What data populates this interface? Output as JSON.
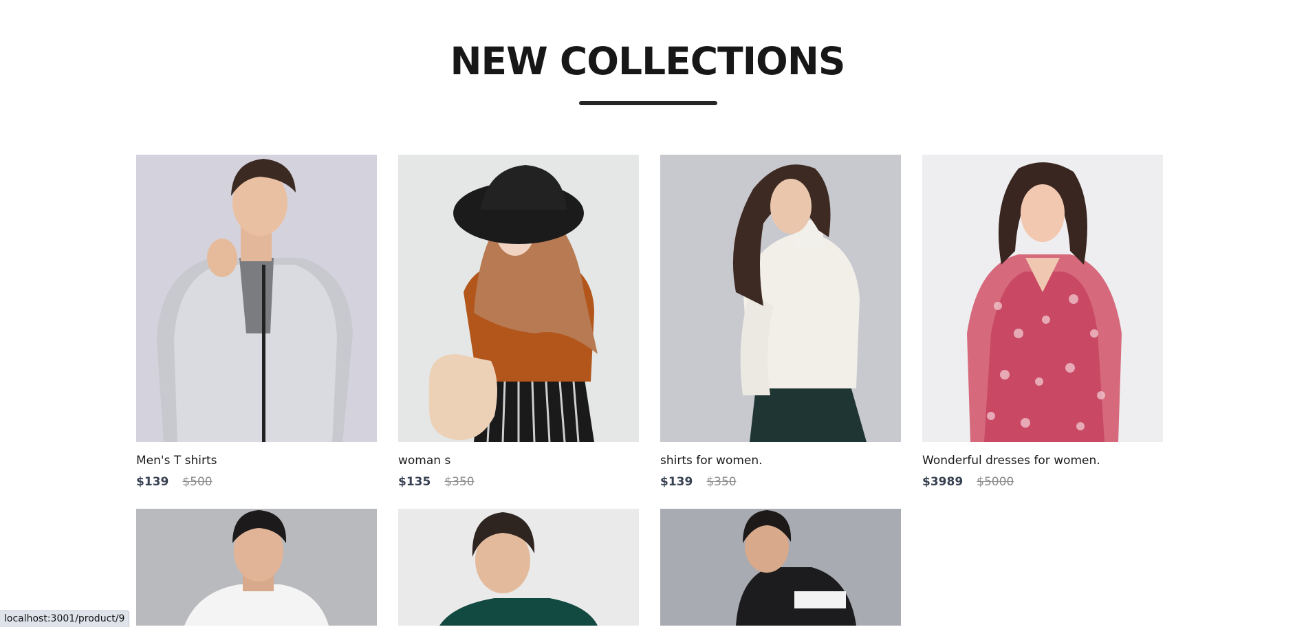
{
  "section": {
    "title": "NEW COLLECTIONS"
  },
  "products": [
    {
      "name": "Men's T shirts",
      "price_new": "$139",
      "price_old": "$500",
      "image": "man-grey-jacket-photo"
    },
    {
      "name": "woman s",
      "price_new": "$135",
      "price_old": "$350",
      "image": "woman-hijab-hat-photo"
    },
    {
      "name": "shirts for women.",
      "price_new": "$139",
      "price_old": "$350",
      "image": "woman-white-turtleneck-photo"
    },
    {
      "name": "Wonderful dresses for women.",
      "price_new": "$3989",
      "price_old": "$5000",
      "image": "woman-floral-dress-photo"
    },
    {
      "image": "man-white-hoodie-photo"
    },
    {
      "image": "boy-green-jacket-photo"
    },
    {
      "image": "boy-black-jacket-photo"
    }
  ],
  "status_bar": {
    "url": "localhost:3001/product/9"
  },
  "colors": {
    "title": "#171717",
    "underline": "#252525",
    "price_new": "#374151",
    "price_old": "#8a8a8a"
  }
}
